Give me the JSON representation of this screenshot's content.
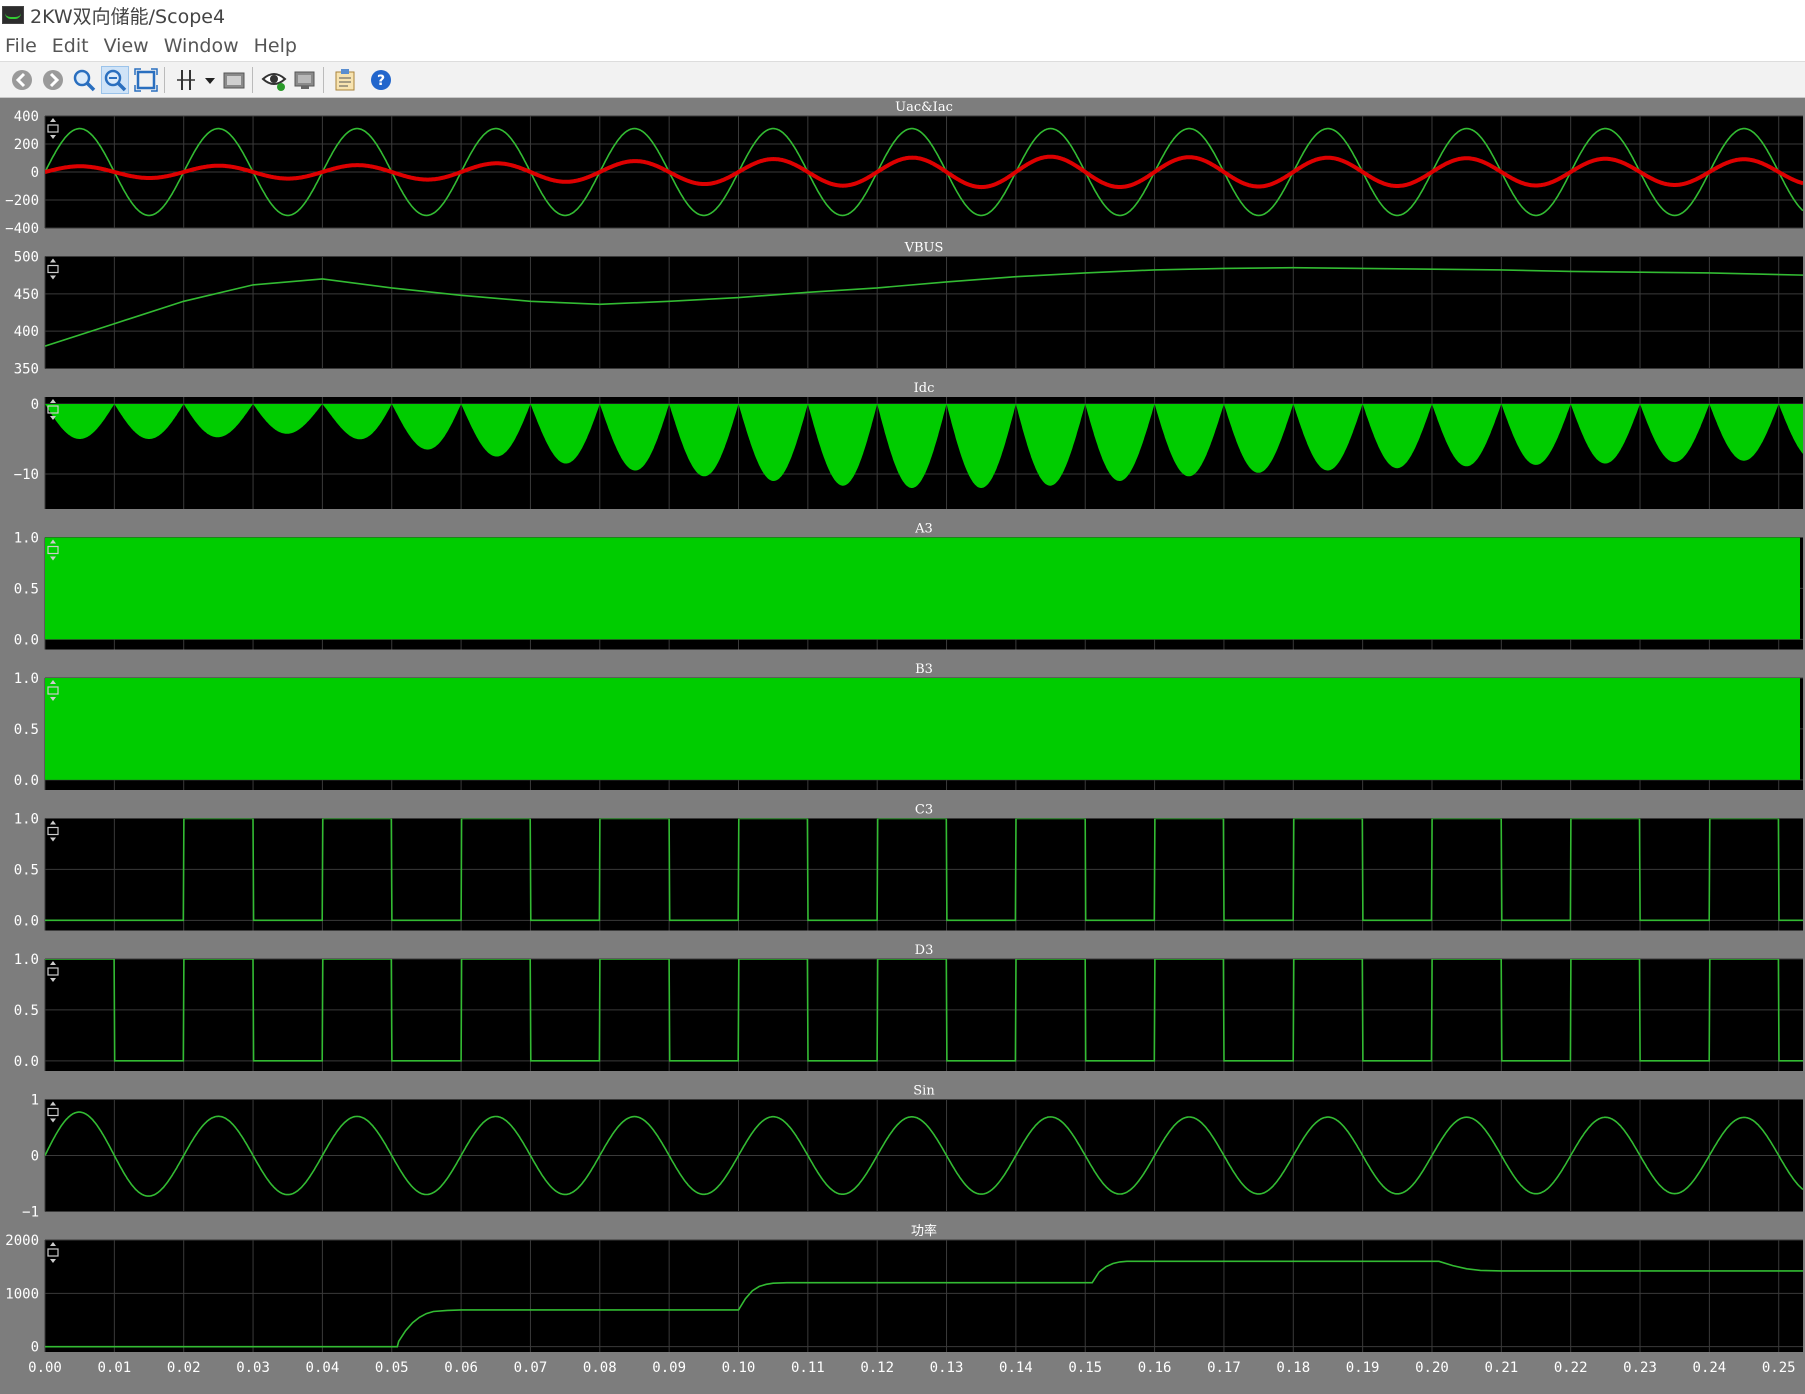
{
  "window": {
    "title": "2KW双向储能/Scope4"
  },
  "menu": [
    "File",
    "Edit",
    "View",
    "Window",
    "Help"
  ],
  "toolbar": {
    "icons": [
      "back-icon",
      "forward-icon",
      "zoom-icon",
      "zoom-x-icon",
      "zoom-box-icon",
      "cursor-icon",
      "dropdown-icon",
      "export-image-icon",
      "view-eye-icon",
      "display-icon",
      "properties-icon",
      "help-icon"
    ]
  },
  "colors": {
    "trace": "#00cc00",
    "trace_thin": "#33bb33",
    "current": "#dd0000",
    "plot_bg": "#000000",
    "frame_bg": "#808080"
  },
  "chart_data": [
    {
      "type": "line",
      "title": "Uac&Iac",
      "ylim": [
        -400,
        400
      ],
      "yticks": [
        "400",
        "200",
        "0",
        "−200",
        "−400"
      ],
      "ytick_values": [
        400,
        200,
        0,
        -200,
        -400
      ],
      "series": [
        {
          "values": [
            {
              "kind": "sine",
              "amp": 310,
              "freq": 50
            }
          ]
        },
        {
          "values": [
            {
              "kind": "sine_env",
              "freq": 50,
              "env": [
                [
                  0,
                  40
                ],
                [
                  0.05,
                  50
                ],
                [
                  0.1,
                  90
                ],
                [
                  0.14,
                  110
                ],
                [
                  0.25,
                  90
                ]
              ]
            }
          ]
        }
      ]
    },
    {
      "type": "line",
      "title": "VBUS",
      "ylim": [
        350,
        500
      ],
      "yticks": [
        "500",
        "450",
        "400",
        "350"
      ],
      "ytick_values": [
        500,
        450,
        400,
        350
      ],
      "series": [
        {
          "values": [
            [
              0,
              380
            ],
            [
              0.01,
              410
            ],
            [
              0.02,
              440
            ],
            [
              0.03,
              462
            ],
            [
              0.04,
              470
            ],
            [
              0.05,
              458
            ],
            [
              0.06,
              448
            ],
            [
              0.07,
              440
            ],
            [
              0.08,
              436
            ],
            [
              0.09,
              440
            ],
            [
              0.1,
              445
            ],
            [
              0.11,
              452
            ],
            [
              0.12,
              458
            ],
            [
              0.13,
              466
            ],
            [
              0.14,
              473
            ],
            [
              0.15,
              478
            ],
            [
              0.16,
              482
            ],
            [
              0.17,
              484
            ],
            [
              0.18,
              485
            ],
            [
              0.19,
              484
            ],
            [
              0.2,
              483
            ],
            [
              0.21,
              482
            ],
            [
              0.22,
              480
            ],
            [
              0.23,
              479
            ],
            [
              0.24,
              478
            ],
            [
              0.254,
              475
            ]
          ]
        }
      ]
    },
    {
      "type": "area",
      "title": "Idc",
      "ylim": [
        -15,
        1
      ],
      "yticks": [
        "0",
        "−10"
      ],
      "ytick_values": [
        0,
        -10
      ],
      "series": [
        {
          "values": [
            {
              "kind": "rectsine_neg",
              "freq": 100,
              "env": [
                [
                  0,
                  5
                ],
                [
                  0.02,
                  5
                ],
                [
                  0.04,
                  4
                ],
                [
                  0.05,
                  6
                ],
                [
                  0.07,
                  8
                ],
                [
                  0.09,
                  10
                ],
                [
                  0.12,
                  12
                ],
                [
                  0.14,
                  12
                ],
                [
                  0.17,
                  10
                ],
                [
                  0.2,
                  9
                ],
                [
                  0.25,
                  8
                ]
              ]
            }
          ]
        }
      ]
    },
    {
      "type": "area",
      "title": "A3",
      "ylim": [
        -0.1,
        1.0
      ],
      "yticks": [
        "1.0",
        "0.5",
        "0.0"
      ],
      "ytick_values": [
        1,
        0.5,
        0
      ],
      "series": [
        {
          "values": [
            [
              0,
              0
            ],
            [
              0.2535,
              1
            ]
          ]
        }
      ]
    },
    {
      "type": "area",
      "title": "B3",
      "ylim": [
        -0.1,
        1.0
      ],
      "yticks": [
        "1.0",
        "0.5",
        "0.0"
      ],
      "ytick_values": [
        1,
        0.5,
        0
      ],
      "series": [
        {
          "values": [
            [
              0,
              0
            ],
            [
              0.2535,
              1
            ]
          ]
        }
      ]
    },
    {
      "type": "line",
      "title": "C3",
      "ylim": [
        -0.1,
        1.0
      ],
      "yticks": [
        "1.0",
        "0.5",
        "0.0"
      ],
      "ytick_values": [
        1,
        0.5,
        0
      ],
      "series": [
        {
          "values": [
            {
              "kind": "square",
              "period": 0.02,
              "phase": 0.01,
              "start_high": false
            }
          ]
        }
      ]
    },
    {
      "type": "line",
      "title": "D3",
      "ylim": [
        -0.1,
        1.0
      ],
      "yticks": [
        "1.0",
        "0.5",
        "0.0"
      ],
      "ytick_values": [
        1,
        0.5,
        0
      ],
      "series": [
        {
          "values": [
            {
              "kind": "square",
              "period": 0.02,
              "phase": 0.0,
              "start_high": true
            }
          ]
        }
      ]
    },
    {
      "type": "line",
      "title": "Sin",
      "ylim": [
        -1,
        1
      ],
      "yticks": [
        "1",
        "0",
        "−1"
      ],
      "ytick_values": [
        1,
        0,
        -1
      ],
      "series": [
        {
          "values": [
            {
              "kind": "sine",
              "amp": 0.7,
              "freq": 50,
              "env": [
                [
                  0,
                  0.8
                ],
                [
                  0.02,
                  0.7
                ],
                [
                  0.25,
                  0.68
                ]
              ]
            }
          ]
        }
      ]
    },
    {
      "type": "line",
      "title": "功率",
      "ylim": [
        -100,
        2000
      ],
      "yticks": [
        "2000",
        "1000",
        "0"
      ],
      "ytick_values": [
        2000,
        1000,
        0
      ],
      "series": [
        {
          "values": [
            [
              0,
              0
            ],
            [
              0.0508,
              0
            ],
            [
              0.051,
              100
            ],
            [
              0.052,
              300
            ],
            [
              0.053,
              450
            ],
            [
              0.054,
              550
            ],
            [
              0.055,
              620
            ],
            [
              0.056,
              660
            ],
            [
              0.058,
              680
            ],
            [
              0.06,
              690
            ],
            [
              0.1,
              690
            ],
            [
              0.101,
              900
            ],
            [
              0.102,
              1050
            ],
            [
              0.103,
              1130
            ],
            [
              0.104,
              1170
            ],
            [
              0.105,
              1190
            ],
            [
              0.107,
              1200
            ],
            [
              0.151,
              1200
            ],
            [
              0.152,
              1400
            ],
            [
              0.153,
              1500
            ],
            [
              0.154,
              1560
            ],
            [
              0.155,
              1590
            ],
            [
              0.156,
              1600
            ],
            [
              0.201,
              1600
            ],
            [
              0.203,
              1520
            ],
            [
              0.205,
              1460
            ],
            [
              0.207,
              1430
            ],
            [
              0.21,
              1420
            ],
            [
              0.2535,
              1420
            ]
          ]
        }
      ]
    }
  ],
  "x_axis": {
    "range": [
      0,
      0.2535
    ],
    "ticks": [
      "0.00",
      "0.01",
      "0.02",
      "0.03",
      "0.04",
      "0.05",
      "0.06",
      "0.07",
      "0.08",
      "0.09",
      "0.10",
      "0.11",
      "0.12",
      "0.13",
      "0.14",
      "0.15",
      "0.16",
      "0.17",
      "0.18",
      "0.19",
      "0.20",
      "0.21",
      "0.22",
      "0.23",
      "0.24",
      "0.25"
    ]
  }
}
